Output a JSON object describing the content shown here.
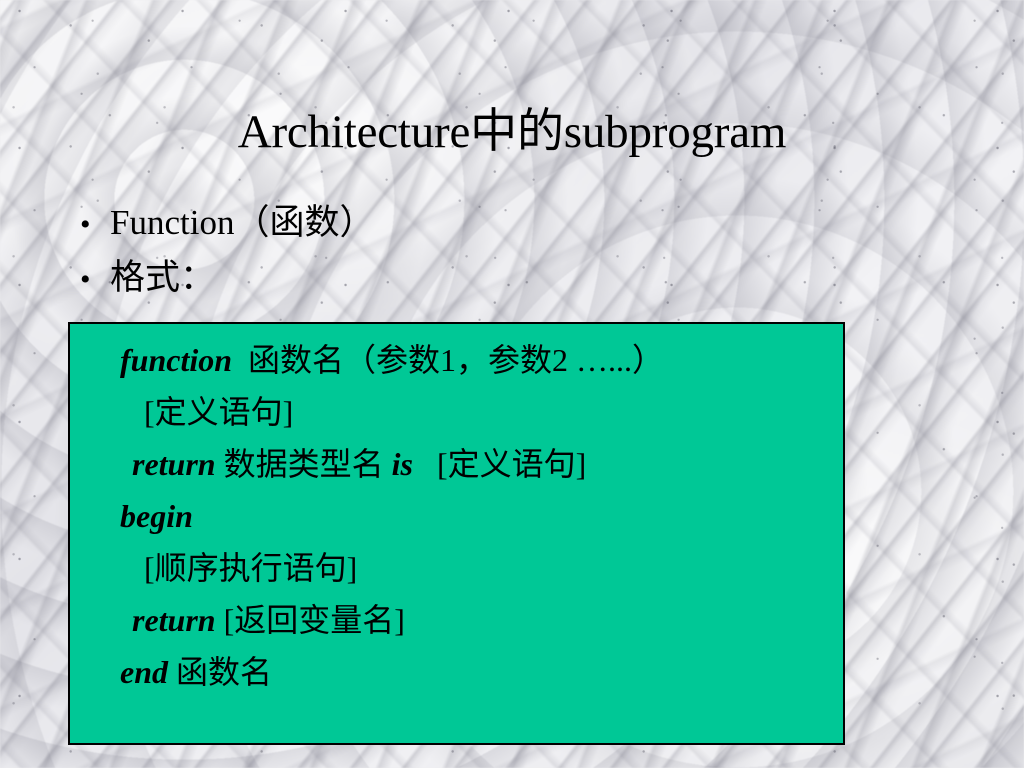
{
  "slide": {
    "title": "Architecture中的subprogram",
    "background": {
      "style": "white-marble-texture",
      "base_color": "#ededf0",
      "vein_color": "#707082"
    }
  },
  "bullets": [
    {
      "marker": "•",
      "text": "Function（函数）"
    },
    {
      "marker": "•",
      "text": "格式："
    }
  ],
  "code_box": {
    "fill_color": "#00c896",
    "border_color": "#000000",
    "text_color": "#000000",
    "lines": [
      {
        "indent": 50,
        "segments": [
          {
            "text": "function",
            "style": "keyword"
          },
          {
            "text": "  函数名（参数1，参数2 …...）",
            "style": "plain"
          }
        ]
      },
      {
        "indent": 74,
        "segments": [
          {
            "text": "[定义语句]",
            "style": "plain"
          }
        ]
      },
      {
        "indent": 62,
        "segments": [
          {
            "text": "return",
            "style": "keyword"
          },
          {
            "text": " 数据类型名 ",
            "style": "plain"
          },
          {
            "text": "is",
            "style": "keyword"
          },
          {
            "text": "   [定义语句]",
            "style": "plain"
          }
        ]
      },
      {
        "indent": 50,
        "segments": [
          {
            "text": "begin",
            "style": "keyword"
          }
        ]
      },
      {
        "indent": 74,
        "segments": [
          {
            "text": "[顺序执行语句]",
            "style": "plain"
          }
        ]
      },
      {
        "indent": 62,
        "segments": [
          {
            "text": "return",
            "style": "keyword"
          },
          {
            "text": " [返回变量名]",
            "style": "plain"
          }
        ]
      },
      {
        "indent": 50,
        "segments": [
          {
            "text": "end",
            "style": "keyword"
          },
          {
            "text": " 函数名",
            "style": "plain"
          }
        ]
      }
    ]
  }
}
